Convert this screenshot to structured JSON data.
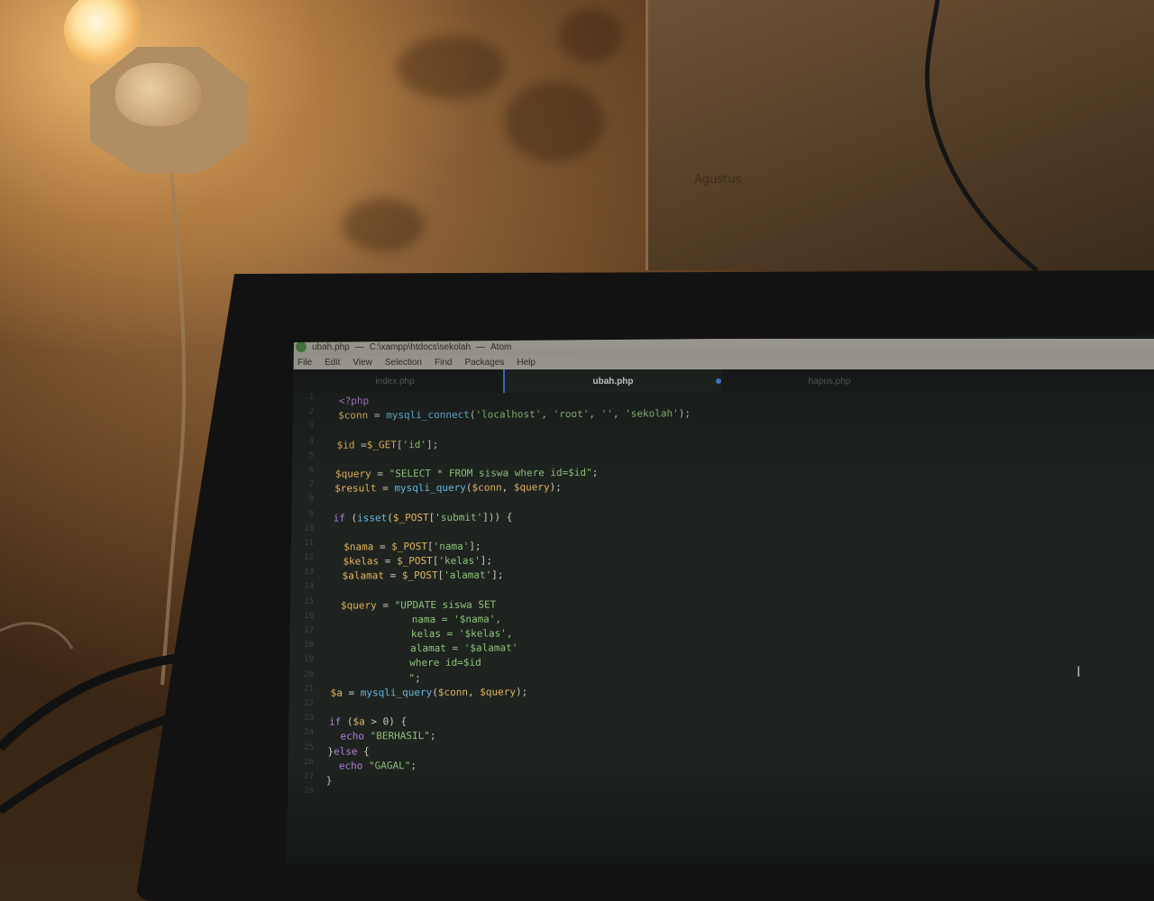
{
  "window": {
    "title_file": "ubah.php",
    "title_path": "C:\\xampp\\htdocs\\sekolah",
    "title_app": "Atom"
  },
  "menu": [
    "File",
    "Edit",
    "View",
    "Selection",
    "Find",
    "Packages",
    "Help"
  ],
  "tabs": [
    {
      "label": "index.php",
      "active": false,
      "modified": false
    },
    {
      "label": "ubah.php",
      "active": true,
      "modified": true
    },
    {
      "label": "hapus.php",
      "active": false,
      "modified": false
    },
    {
      "label": "",
      "active": false,
      "modified": false
    }
  ],
  "background": {
    "paper_text": "Agustus"
  },
  "code_lines": [
    [
      [
        "kw",
        "<?php"
      ]
    ],
    [
      [
        "var",
        "$conn"
      ],
      [
        "txt",
        " = "
      ],
      [
        "fn",
        "mysqli_connect"
      ],
      [
        "txt",
        "("
      ],
      [
        "str",
        "'localhost'"
      ],
      [
        "txt",
        ", "
      ],
      [
        "str",
        "'root'"
      ],
      [
        "txt",
        ", "
      ],
      [
        "str",
        "''"
      ],
      [
        "txt",
        ", "
      ],
      [
        "str",
        "'sekolah'"
      ],
      [
        "txt",
        ");"
      ]
    ],
    [],
    [
      [
        "var",
        "$id"
      ],
      [
        "txt",
        " ="
      ],
      [
        "var",
        "$_GET"
      ],
      [
        "txt",
        "["
      ],
      [
        "str",
        "'id'"
      ],
      [
        "txt",
        "];"
      ]
    ],
    [],
    [
      [
        "var",
        "$query"
      ],
      [
        "txt",
        " = "
      ],
      [
        "str",
        "\"SELECT * FROM siswa where id=$id\""
      ],
      [
        "txt",
        ";"
      ]
    ],
    [
      [
        "var",
        "$result"
      ],
      [
        "txt",
        " = "
      ],
      [
        "fn",
        "mysqli_query"
      ],
      [
        "txt",
        "("
      ],
      [
        "var",
        "$conn"
      ],
      [
        "txt",
        ", "
      ],
      [
        "var",
        "$query"
      ],
      [
        "txt",
        ");"
      ]
    ],
    [],
    [
      [
        "kw",
        "if"
      ],
      [
        "txt",
        " ("
      ],
      [
        "fn",
        "isset"
      ],
      [
        "txt",
        "("
      ],
      [
        "var",
        "$_POST"
      ],
      [
        "txt",
        "["
      ],
      [
        "str",
        "'submit'"
      ],
      [
        "txt",
        "])) {"
      ]
    ],
    [],
    [
      [
        "txt",
        "  "
      ],
      [
        "var",
        "$nama"
      ],
      [
        "txt",
        " = "
      ],
      [
        "var",
        "$_POST"
      ],
      [
        "txt",
        "["
      ],
      [
        "str",
        "'nama'"
      ],
      [
        "txt",
        "];"
      ]
    ],
    [
      [
        "txt",
        "  "
      ],
      [
        "var",
        "$kelas"
      ],
      [
        "txt",
        " = "
      ],
      [
        "var",
        "$_POST"
      ],
      [
        "txt",
        "["
      ],
      [
        "str",
        "'kelas'"
      ],
      [
        "txt",
        "];"
      ]
    ],
    [
      [
        "txt",
        "  "
      ],
      [
        "var",
        "$alamat"
      ],
      [
        "txt",
        " = "
      ],
      [
        "var",
        "$_POST"
      ],
      [
        "txt",
        "["
      ],
      [
        "str",
        "'alamat'"
      ],
      [
        "txt",
        "];"
      ]
    ],
    [],
    [
      [
        "txt",
        "  "
      ],
      [
        "var",
        "$query"
      ],
      [
        "txt",
        " = "
      ],
      [
        "str",
        "\"UPDATE siswa SET"
      ]
    ],
    [
      [
        "str",
        "              nama = '$nama',"
      ]
    ],
    [
      [
        "str",
        "              kelas = '$kelas',"
      ]
    ],
    [
      [
        "str",
        "              alamat = '$alamat'"
      ]
    ],
    [
      [
        "str",
        "              where id=$id"
      ]
    ],
    [
      [
        "str",
        "              \""
      ],
      [
        "txt",
        ";"
      ]
    ],
    [
      [
        "txt",
        " "
      ],
      [
        "var",
        "$a"
      ],
      [
        "txt",
        " = "
      ],
      [
        "fn",
        "mysqli_query"
      ],
      [
        "txt",
        "("
      ],
      [
        "var",
        "$conn"
      ],
      [
        "txt",
        ", "
      ],
      [
        "var",
        "$query"
      ],
      [
        "txt",
        ");"
      ]
    ],
    [],
    [
      [
        "txt",
        " "
      ],
      [
        "kw",
        "if"
      ],
      [
        "txt",
        " ("
      ],
      [
        "var",
        "$a"
      ],
      [
        "txt",
        " > 0) {"
      ]
    ],
    [
      [
        "txt",
        "   "
      ],
      [
        "kw",
        "echo"
      ],
      [
        "txt",
        " "
      ],
      [
        "str",
        "\"BERHASIL\""
      ],
      [
        "txt",
        ";"
      ]
    ],
    [
      [
        "txt",
        " }"
      ],
      [
        "kw",
        "else"
      ],
      [
        "txt",
        " {"
      ]
    ],
    [
      [
        "txt",
        "   "
      ],
      [
        "kw",
        "echo"
      ],
      [
        "txt",
        " "
      ],
      [
        "str",
        "\"GAGAL\""
      ],
      [
        "txt",
        ";"
      ]
    ],
    [
      [
        "txt",
        " }"
      ]
    ],
    []
  ],
  "gutter_numbers": [
    "1",
    "2",
    "3",
    "4",
    "5",
    "6",
    "7",
    "8",
    "9",
    "10",
    "11",
    "12",
    "13",
    "14",
    "15",
    "16",
    "17",
    "18",
    "19",
    "20",
    "21",
    "22",
    "23",
    "24",
    "25",
    "26",
    "27",
    "28"
  ],
  "colors": {
    "keyword": "#b880d8",
    "variable": "#e3b45d",
    "string": "#8fc37a",
    "function": "#67b8de"
  },
  "icons": {
    "cursor": "text-cursor-icon",
    "app": "atom-icon"
  }
}
